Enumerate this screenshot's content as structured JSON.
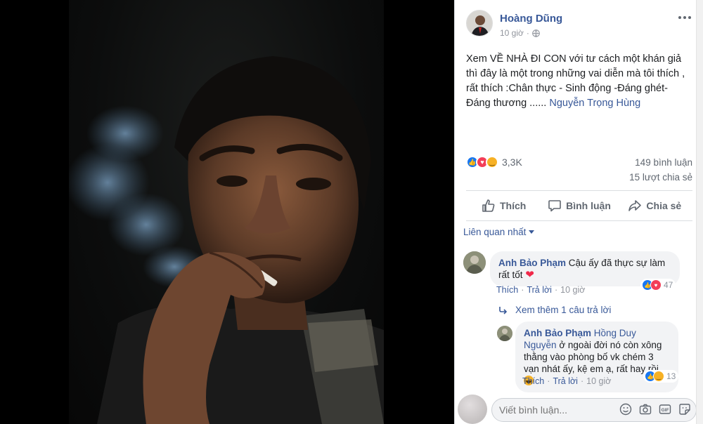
{
  "post": {
    "author": "Hoàng Dũng",
    "time": "10 giờ",
    "text_before": "Xem VỀ NHÀ ĐI CON với tư cách một khán giả thì đây là một trong những vai diễn mà tôi thích , rất thích :Chân thực - Sinh động -Đáng ghét- Đáng thương ......",
    "mention": "Nguyễn Trọng Hùng",
    "reactions_count": "3,3K",
    "comments_count": "149 bình luận",
    "shares_count": "15 lượt chia sẻ"
  },
  "actions": {
    "like": "Thích",
    "comment": "Bình luận",
    "share": "Chia sẻ"
  },
  "sort": {
    "label": "Liên quan nhất"
  },
  "comments": [
    {
      "author": "Anh Bảo Phạm",
      "text": "Cậu ấy đã thực sự làm rất tốt",
      "like": "Thích",
      "reply": "Trả lời",
      "time": "10 giờ",
      "reactions": "47"
    }
  ],
  "view_replies": "Xem thêm 1 câu trả lời",
  "reply": {
    "author": "Anh Bảo Phạm",
    "mention": "Hồng Duy Nguyễn",
    "text": "ở ngoài đời nó còn xông thằng vào phòng bố vk chém 3 vạn nhát ấy, kệ em ạ, rất hay rồi",
    "like": "Thích",
    "reply": "Trả lời",
    "time": "10 giờ",
    "reactions": "13"
  },
  "composer": {
    "placeholder": "Viết bình luận..."
  },
  "icons": [
    "globe-icon",
    "more-icon",
    "like-icon",
    "comment-icon",
    "share-icon",
    "reply-arrow-icon",
    "emoji-icon",
    "camera-icon",
    "gif-icon",
    "sticker-icon"
  ],
  "colors": {
    "link": "#385898",
    "like": "#1877f2",
    "love": "#f33e58",
    "haha": "#f7b125"
  }
}
